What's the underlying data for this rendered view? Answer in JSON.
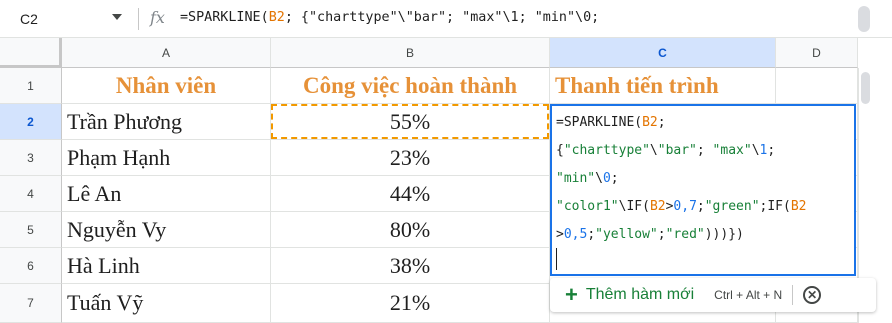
{
  "name_box": {
    "value": "C2"
  },
  "formula_bar": {
    "fx_label": "fx",
    "tokens": [
      {
        "t": "=SPARKLINE(",
        "c": ""
      },
      {
        "t": "B2",
        "c": "ref"
      },
      {
        "t": "; {\"charttype\"\\\"bar\"; \"max\"\\1; \"min\"\\0;",
        "c": ""
      }
    ]
  },
  "columns": [
    "A",
    "B",
    "C",
    "D"
  ],
  "rows": [
    "1",
    "2",
    "3",
    "4",
    "5",
    "6",
    "7"
  ],
  "headers": {
    "a": "Nhân viên",
    "b": "Công việc hoàn thành",
    "c": "Thanh tiến trình"
  },
  "data_rows": [
    {
      "name": "Trần Phương",
      "percent": "55%"
    },
    {
      "name": "Phạm Hạnh",
      "percent": "23%"
    },
    {
      "name": "Lê An",
      "percent": "44%"
    },
    {
      "name": "Nguyễn Vy",
      "percent": "80%"
    },
    {
      "name": "Hà Linh",
      "percent": "38%"
    },
    {
      "name": "Tuấn Vỹ",
      "percent": "21%"
    }
  ],
  "editor_lines": [
    [
      {
        "t": "=SPARKLINE(",
        "c": ""
      },
      {
        "t": "B2",
        "c": "ref"
      },
      {
        "t": ";",
        "c": ""
      }
    ],
    [
      {
        "t": "{",
        "c": ""
      },
      {
        "t": "\"charttype\"",
        "c": "str"
      },
      {
        "t": "\\",
        "c": ""
      },
      {
        "t": "\"bar\"",
        "c": "str"
      },
      {
        "t": "; ",
        "c": ""
      },
      {
        "t": "\"max\"",
        "c": "str"
      },
      {
        "t": "\\",
        "c": ""
      },
      {
        "t": "1",
        "c": "num"
      },
      {
        "t": ";",
        "c": ""
      }
    ],
    [
      {
        "t": "\"min\"",
        "c": "str"
      },
      {
        "t": "\\",
        "c": ""
      },
      {
        "t": "0",
        "c": "num"
      },
      {
        "t": ";",
        "c": ""
      }
    ],
    [
      {
        "t": "\"color1\"",
        "c": "str"
      },
      {
        "t": "\\IF(",
        "c": ""
      },
      {
        "t": "B2",
        "c": "ref"
      },
      {
        "t": ">",
        "c": ""
      },
      {
        "t": "0,7",
        "c": "num"
      },
      {
        "t": ";",
        "c": ""
      },
      {
        "t": "\"green\"",
        "c": "str"
      },
      {
        "t": ";IF(",
        "c": ""
      },
      {
        "t": "B2",
        "c": "ref"
      }
    ],
    [
      {
        "t": ">",
        "c": ""
      },
      {
        "t": "0,5",
        "c": "num"
      },
      {
        "t": ";",
        "c": ""
      },
      {
        "t": "\"yellow\"",
        "c": "str"
      },
      {
        "t": ";",
        "c": ""
      },
      {
        "t": "\"red\"",
        "c": "str"
      },
      {
        "t": ")))",
        "c": ""
      },
      {
        "t": "})",
        "c": ""
      }
    ]
  ],
  "suggestion": {
    "add_icon": "plus-icon",
    "label": "Thêm hàm mới",
    "shortcut": "Ctrl + Alt + N",
    "close_icon": "close-circle-icon"
  },
  "colors": {
    "header_text": "#e69138",
    "selection": "#1a73e8",
    "copy_border": "#f29900",
    "function_green": "#188038"
  }
}
